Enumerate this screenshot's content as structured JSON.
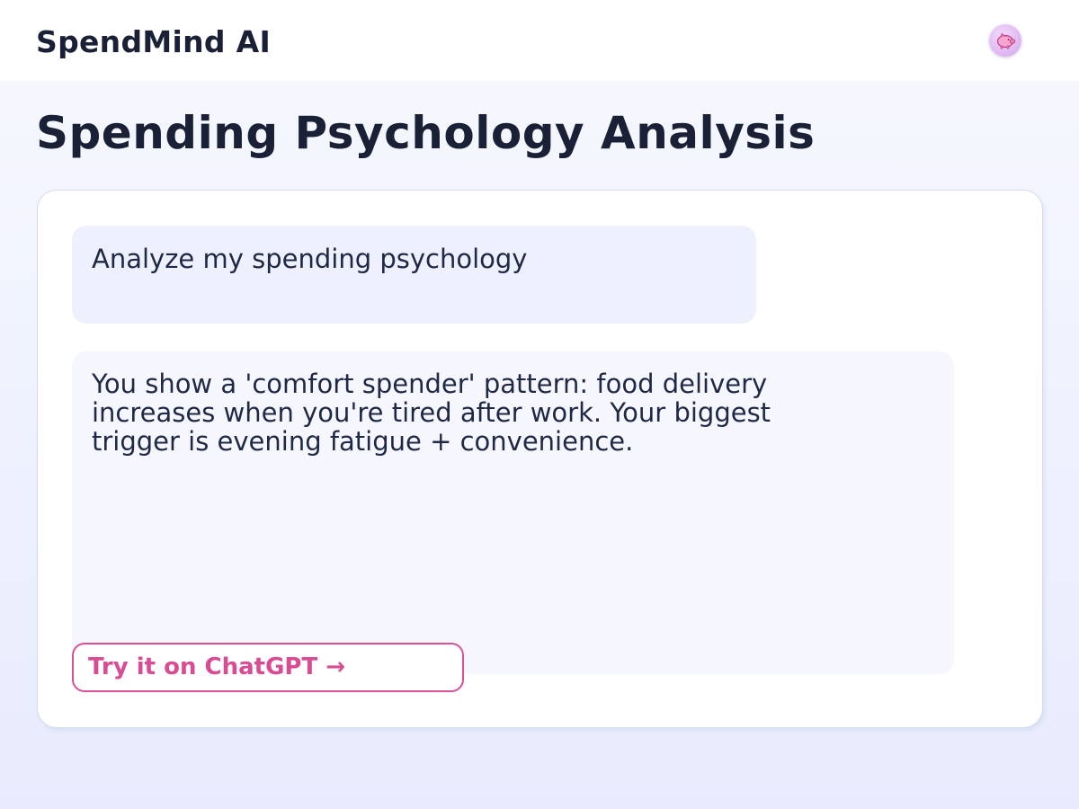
{
  "app": {
    "title": "SpendMind AI",
    "avatar_icon": "piggy-bank-icon"
  },
  "page": {
    "title": "Spending Psychology Analysis"
  },
  "chat": {
    "user_message": "Analyze my spending psychology",
    "ai_message": "You show a 'comfort spender' pattern: food delivery increases when you're tired after work. Your biggest trigger is evening fatigue + convenience."
  },
  "cta": {
    "label": "Try it on ChatGPT →"
  },
  "colors": {
    "accent": "#dc5196",
    "text_dark": "#1a2035",
    "user_bubble": "#eef1fd",
    "ai_bubble": "#f6f7fe"
  }
}
